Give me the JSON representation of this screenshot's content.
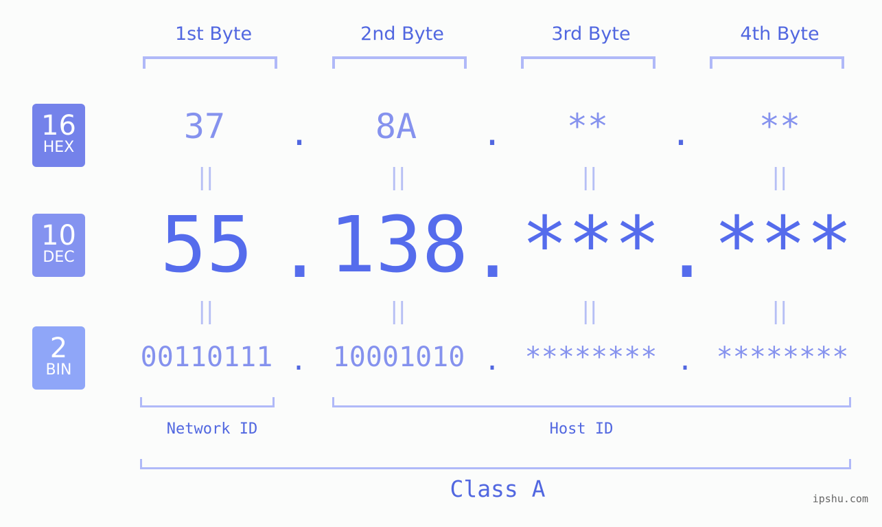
{
  "bytes": [
    {
      "label": "1st Byte",
      "hex": "37",
      "dec": "55",
      "bin": "00110111"
    },
    {
      "label": "2nd Byte",
      "hex": "8A",
      "dec": "138",
      "bin": "10001010"
    },
    {
      "label": "3rd Byte",
      "hex": "**",
      "dec": "***",
      "bin": "********"
    },
    {
      "label": "4th Byte",
      "hex": "**",
      "dec": "***",
      "bin": "********"
    }
  ],
  "badges": {
    "hex": {
      "num": "16",
      "label": "HEX",
      "color": "#7482ea"
    },
    "dec": {
      "num": "10",
      "label": "DEC",
      "color": "#8493f0"
    },
    "bin": {
      "num": "2",
      "label": "BIN",
      "color": "#8fa6f8"
    }
  },
  "separator": ".",
  "equals": "||",
  "network_id_label": "Network ID",
  "host_id_label": "Host ID",
  "class_label": "Class A",
  "watermark": "ipshu.com"
}
